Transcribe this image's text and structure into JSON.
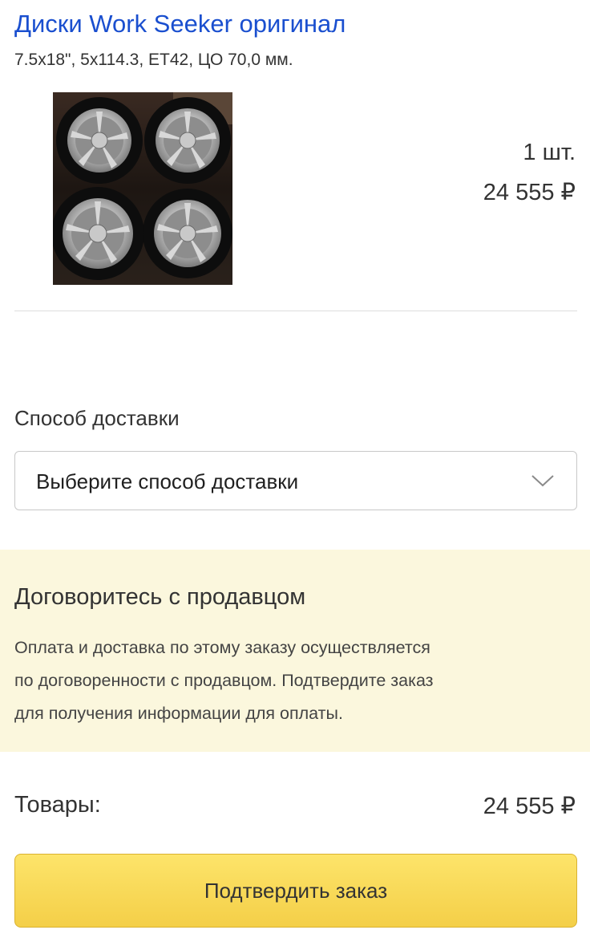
{
  "product": {
    "title": "Диски Work Seeker оригинал",
    "specs": "7.5x18\", 5x114.3, ET42, ЦО 70,0 мм.",
    "quantity": "1 шт.",
    "price": "24 555 ₽",
    "image_icon": "wheels-photo"
  },
  "delivery": {
    "label": "Способ доставки",
    "select_value": "Выберите способ доставки",
    "chevron_icon": "chevron-down-icon"
  },
  "notice": {
    "title": "Договоритесь с продавцом",
    "lines": [
      "Оплата и доставка по этому заказу осуществляется",
      "по договоренности с продавцом. Подтвердите заказ",
      "для получения информации для оплаты."
    ]
  },
  "summary": {
    "label": "Товары:",
    "value": "24 555 ₽"
  },
  "actions": {
    "confirm_label": "Подтвердить заказ"
  },
  "colors": {
    "link": "#1a4fcf",
    "notice_bg": "#fbf7dd",
    "button_bg": "#f8d74e"
  }
}
